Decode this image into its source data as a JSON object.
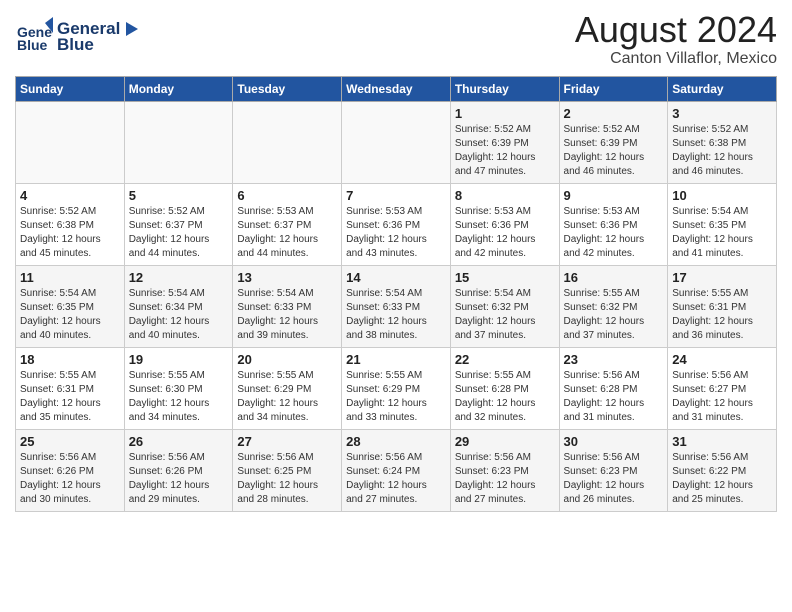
{
  "logo": {
    "line1": "General",
    "line2": "Blue"
  },
  "title": "August 2024",
  "subtitle": "Canton Villaflor, Mexico",
  "days_of_week": [
    "Sunday",
    "Monday",
    "Tuesday",
    "Wednesday",
    "Thursday",
    "Friday",
    "Saturday"
  ],
  "weeks": [
    [
      {
        "day": "",
        "info": ""
      },
      {
        "day": "",
        "info": ""
      },
      {
        "day": "",
        "info": ""
      },
      {
        "day": "",
        "info": ""
      },
      {
        "day": "1",
        "info": "Sunrise: 5:52 AM\nSunset: 6:39 PM\nDaylight: 12 hours\nand 47 minutes."
      },
      {
        "day": "2",
        "info": "Sunrise: 5:52 AM\nSunset: 6:39 PM\nDaylight: 12 hours\nand 46 minutes."
      },
      {
        "day": "3",
        "info": "Sunrise: 5:52 AM\nSunset: 6:38 PM\nDaylight: 12 hours\nand 46 minutes."
      }
    ],
    [
      {
        "day": "4",
        "info": "Sunrise: 5:52 AM\nSunset: 6:38 PM\nDaylight: 12 hours\nand 45 minutes."
      },
      {
        "day": "5",
        "info": "Sunrise: 5:52 AM\nSunset: 6:37 PM\nDaylight: 12 hours\nand 44 minutes."
      },
      {
        "day": "6",
        "info": "Sunrise: 5:53 AM\nSunset: 6:37 PM\nDaylight: 12 hours\nand 44 minutes."
      },
      {
        "day": "7",
        "info": "Sunrise: 5:53 AM\nSunset: 6:36 PM\nDaylight: 12 hours\nand 43 minutes."
      },
      {
        "day": "8",
        "info": "Sunrise: 5:53 AM\nSunset: 6:36 PM\nDaylight: 12 hours\nand 42 minutes."
      },
      {
        "day": "9",
        "info": "Sunrise: 5:53 AM\nSunset: 6:36 PM\nDaylight: 12 hours\nand 42 minutes."
      },
      {
        "day": "10",
        "info": "Sunrise: 5:54 AM\nSunset: 6:35 PM\nDaylight: 12 hours\nand 41 minutes."
      }
    ],
    [
      {
        "day": "11",
        "info": "Sunrise: 5:54 AM\nSunset: 6:35 PM\nDaylight: 12 hours\nand 40 minutes."
      },
      {
        "day": "12",
        "info": "Sunrise: 5:54 AM\nSunset: 6:34 PM\nDaylight: 12 hours\nand 40 minutes."
      },
      {
        "day": "13",
        "info": "Sunrise: 5:54 AM\nSunset: 6:33 PM\nDaylight: 12 hours\nand 39 minutes."
      },
      {
        "day": "14",
        "info": "Sunrise: 5:54 AM\nSunset: 6:33 PM\nDaylight: 12 hours\nand 38 minutes."
      },
      {
        "day": "15",
        "info": "Sunrise: 5:54 AM\nSunset: 6:32 PM\nDaylight: 12 hours\nand 37 minutes."
      },
      {
        "day": "16",
        "info": "Sunrise: 5:55 AM\nSunset: 6:32 PM\nDaylight: 12 hours\nand 37 minutes."
      },
      {
        "day": "17",
        "info": "Sunrise: 5:55 AM\nSunset: 6:31 PM\nDaylight: 12 hours\nand 36 minutes."
      }
    ],
    [
      {
        "day": "18",
        "info": "Sunrise: 5:55 AM\nSunset: 6:31 PM\nDaylight: 12 hours\nand 35 minutes."
      },
      {
        "day": "19",
        "info": "Sunrise: 5:55 AM\nSunset: 6:30 PM\nDaylight: 12 hours\nand 34 minutes."
      },
      {
        "day": "20",
        "info": "Sunrise: 5:55 AM\nSunset: 6:29 PM\nDaylight: 12 hours\nand 34 minutes."
      },
      {
        "day": "21",
        "info": "Sunrise: 5:55 AM\nSunset: 6:29 PM\nDaylight: 12 hours\nand 33 minutes."
      },
      {
        "day": "22",
        "info": "Sunrise: 5:55 AM\nSunset: 6:28 PM\nDaylight: 12 hours\nand 32 minutes."
      },
      {
        "day": "23",
        "info": "Sunrise: 5:56 AM\nSunset: 6:28 PM\nDaylight: 12 hours\nand 31 minutes."
      },
      {
        "day": "24",
        "info": "Sunrise: 5:56 AM\nSunset: 6:27 PM\nDaylight: 12 hours\nand 31 minutes."
      }
    ],
    [
      {
        "day": "25",
        "info": "Sunrise: 5:56 AM\nSunset: 6:26 PM\nDaylight: 12 hours\nand 30 minutes."
      },
      {
        "day": "26",
        "info": "Sunrise: 5:56 AM\nSunset: 6:26 PM\nDaylight: 12 hours\nand 29 minutes."
      },
      {
        "day": "27",
        "info": "Sunrise: 5:56 AM\nSunset: 6:25 PM\nDaylight: 12 hours\nand 28 minutes."
      },
      {
        "day": "28",
        "info": "Sunrise: 5:56 AM\nSunset: 6:24 PM\nDaylight: 12 hours\nand 27 minutes."
      },
      {
        "day": "29",
        "info": "Sunrise: 5:56 AM\nSunset: 6:23 PM\nDaylight: 12 hours\nand 27 minutes."
      },
      {
        "day": "30",
        "info": "Sunrise: 5:56 AM\nSunset: 6:23 PM\nDaylight: 12 hours\nand 26 minutes."
      },
      {
        "day": "31",
        "info": "Sunrise: 5:56 AM\nSunset: 6:22 PM\nDaylight: 12 hours\nand 25 minutes."
      }
    ]
  ]
}
